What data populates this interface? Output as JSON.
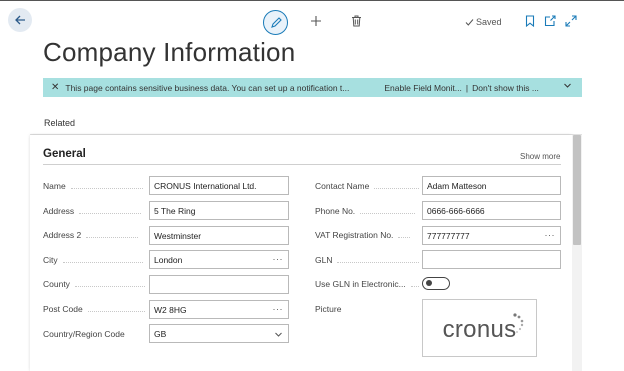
{
  "topbar": {
    "saved_label": "Saved"
  },
  "page": {
    "title": "Company Information"
  },
  "banner": {
    "message": "This page contains sensitive business data. You can set up a notification t...",
    "enable_link": "Enable Field Monit...",
    "separator": "|",
    "dismiss_link": "Don't show this ..."
  },
  "nav": {
    "related_label": "Related"
  },
  "general": {
    "title": "General",
    "show_more": "Show more",
    "left_fields": [
      {
        "label": "Name",
        "value": "CRONUS International Ltd."
      },
      {
        "label": "Address",
        "value": "5 The Ring"
      },
      {
        "label": "Address 2",
        "value": "Westminster"
      },
      {
        "label": "City",
        "value": "London"
      },
      {
        "label": "County",
        "value": ""
      },
      {
        "label": "Post Code",
        "value": "W2 8HG"
      },
      {
        "label": "Country/Region Code",
        "value": "GB"
      }
    ],
    "right_fields": [
      {
        "label": "Contact Name",
        "value": "Adam Matteson"
      },
      {
        "label": "Phone No.",
        "value": "0666-666-6666"
      },
      {
        "label": "VAT Registration No.",
        "value": "777777777"
      },
      {
        "label": "GLN",
        "value": ""
      },
      {
        "label": "Use GLN in Electronic...",
        "value": "off"
      },
      {
        "label": "Picture",
        "value": ""
      }
    ],
    "ellipsis": "···",
    "logo_text": "cronus"
  },
  "colors": {
    "banner_bg": "#a7e0e0",
    "accent": "#1a7bb8"
  }
}
